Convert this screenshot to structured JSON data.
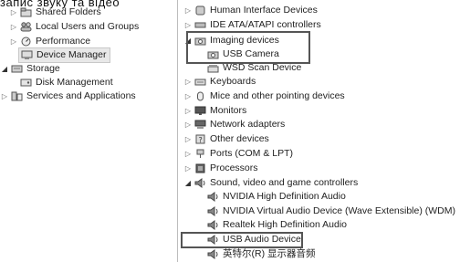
{
  "caption": "запис звуку та відео",
  "left_tree": [
    {
      "label": "Shared Folders",
      "arrow": "collapsed",
      "icon": "shared-folder-icon"
    },
    {
      "label": "Local Users and Groups",
      "arrow": "collapsed",
      "icon": "users-icon"
    },
    {
      "label": "Performance",
      "arrow": "collapsed",
      "icon": "performance-icon"
    },
    {
      "label": "Device Manager",
      "arrow": "none",
      "icon": "device-manager-icon",
      "selected": true
    },
    {
      "label": "Storage",
      "arrow": "expanded",
      "icon": "storage-icon"
    },
    {
      "label": "Disk Management",
      "arrow": "none",
      "icon": "disk-icon"
    },
    {
      "label": "Services and Applications",
      "arrow": "collapsed",
      "icon": "services-icon"
    }
  ],
  "device_tree": [
    {
      "label": "Human Interface Devices",
      "arrow": "collapsed",
      "icon": "hid-icon"
    },
    {
      "label": "IDE ATA/ATAPI controllers",
      "arrow": "collapsed",
      "icon": "ide-icon"
    },
    {
      "label": "Imaging devices",
      "arrow": "expanded",
      "icon": "camera-icon"
    },
    {
      "label": "USB Camera",
      "arrow": "none",
      "icon": "camera-icon"
    },
    {
      "label": "WSD Scan Device",
      "arrow": "none",
      "icon": "scanner-icon"
    },
    {
      "label": "Keyboards",
      "arrow": "collapsed",
      "icon": "keyboard-icon"
    },
    {
      "label": "Mice and other pointing devices",
      "arrow": "collapsed",
      "icon": "mouse-icon"
    },
    {
      "label": "Monitors",
      "arrow": "collapsed",
      "icon": "monitor-icon"
    },
    {
      "label": "Network adapters",
      "arrow": "collapsed",
      "icon": "network-icon"
    },
    {
      "label": "Other devices",
      "arrow": "collapsed",
      "icon": "unknown-device-icon"
    },
    {
      "label": "Ports (COM & LPT)",
      "arrow": "collapsed",
      "icon": "port-icon"
    },
    {
      "label": "Processors",
      "arrow": "collapsed",
      "icon": "processor-icon"
    },
    {
      "label": "Sound, video and game controllers",
      "arrow": "expanded",
      "icon": "speaker-icon"
    },
    {
      "label": "NVIDIA High Definition Audio",
      "arrow": "none",
      "icon": "speaker-icon"
    },
    {
      "label": "NVIDIA Virtual Audio Device (Wave Extensible) (WDM)",
      "arrow": "none",
      "icon": "speaker-icon"
    },
    {
      "label": "Realtek High Definition Audio",
      "arrow": "none",
      "icon": "speaker-icon"
    },
    {
      "label": "USB Audio Device",
      "arrow": "none",
      "icon": "speaker-icon"
    },
    {
      "label": "英特尔(R) 显示器音频",
      "arrow": "none",
      "icon": "speaker-icon"
    }
  ],
  "arrow_glyphs": {
    "collapsed": "▷",
    "expanded": "◢",
    "none": ""
  }
}
